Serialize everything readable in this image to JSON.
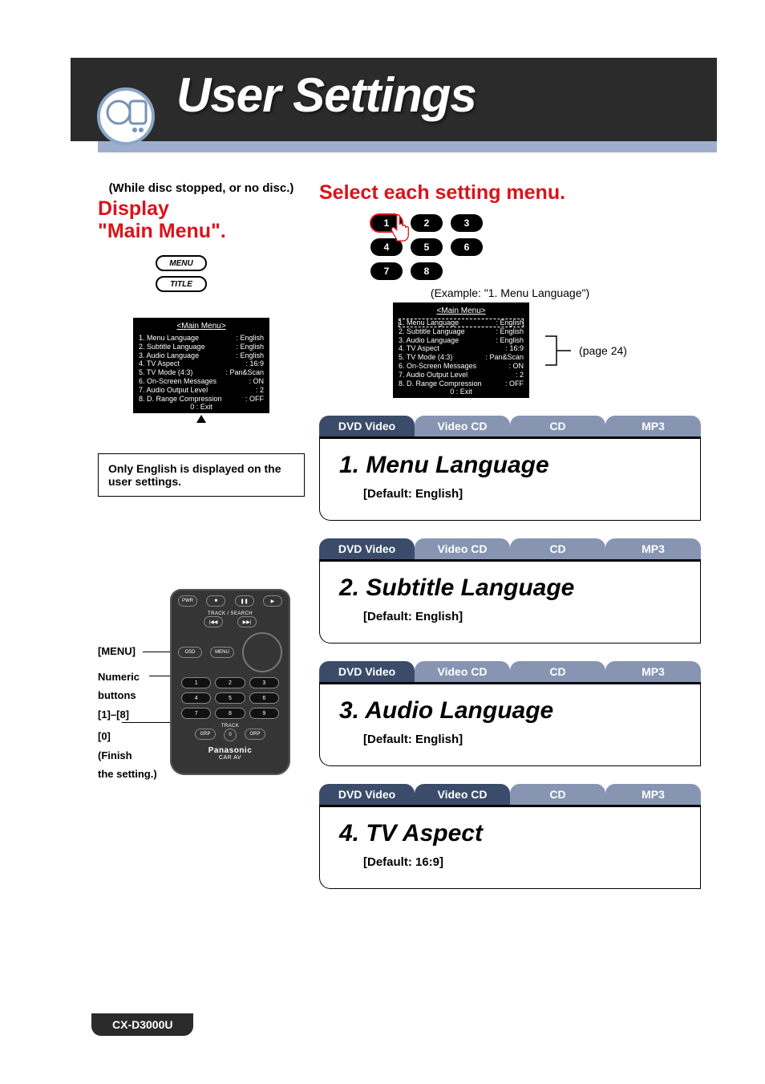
{
  "header": {
    "title": "User Settings"
  },
  "left": {
    "precondition": "(While disc stopped, or no disc.)",
    "display_heading": "Display",
    "main_menu_heading": "\"Main Menu\".",
    "menu_button_label": "MENU",
    "title_button_label": "TITLE",
    "note": "Only English is displayed on the user settings."
  },
  "menu_box": {
    "title": "<Main Menu>",
    "items": [
      {
        "label": "1. Menu Language",
        "value": ": English"
      },
      {
        "label": "2. Subtitle Language",
        "value": ": English"
      },
      {
        "label": "3. Audio Language",
        "value": ": English"
      },
      {
        "label": "4. TV Aspect",
        "value": ": 16:9"
      },
      {
        "label": "5. TV Mode (4:3)",
        "value": ": Pan&Scan"
      },
      {
        "label": "6. On-Screen Messages",
        "value": ": ON"
      },
      {
        "label": "7. Audio Output Level",
        "value": ": 2"
      },
      {
        "label": "8. D. Range Compression",
        "value": ": OFF"
      }
    ],
    "exit": "0 : Exit"
  },
  "right": {
    "heading": "Select each setting menu.",
    "example": "(Example: \"1. Menu Language\")",
    "page_ref": "(page 24)",
    "num_buttons": [
      "1",
      "2",
      "3",
      "4",
      "5",
      "6",
      "7",
      "8"
    ]
  },
  "tabs": {
    "dvd": "DVD Video",
    "vcd": "Video CD",
    "cd": "CD",
    "mp3": "MP3"
  },
  "settings": [
    {
      "title": "1.  Menu Language",
      "default": "[Default: English]",
      "active": [
        "dvd"
      ]
    },
    {
      "title": "2.  Subtitle Language",
      "default": "[Default: English]",
      "active": [
        "dvd"
      ]
    },
    {
      "title": "3.  Audio Language",
      "default": "[Default: English]",
      "active": [
        "dvd"
      ]
    },
    {
      "title": "4.  TV Aspect",
      "default": "[Default: 16:9]",
      "active": [
        "dvd",
        "vcd"
      ]
    }
  ],
  "remote": {
    "label_menu": "[MENU]",
    "label_numeric_1": "Numeric",
    "label_numeric_2": "buttons",
    "label_numeric_3": "[1]–[8]",
    "label_zero_1": "[0]",
    "label_zero_2": "(Finish",
    "label_zero_3": "the setting.)",
    "brand": "Panasonic",
    "brand2": "CAR AV",
    "track_search": "TRACK / SEARCH",
    "track": "TRACK"
  },
  "footer": {
    "model": "CX-D3000U"
  }
}
